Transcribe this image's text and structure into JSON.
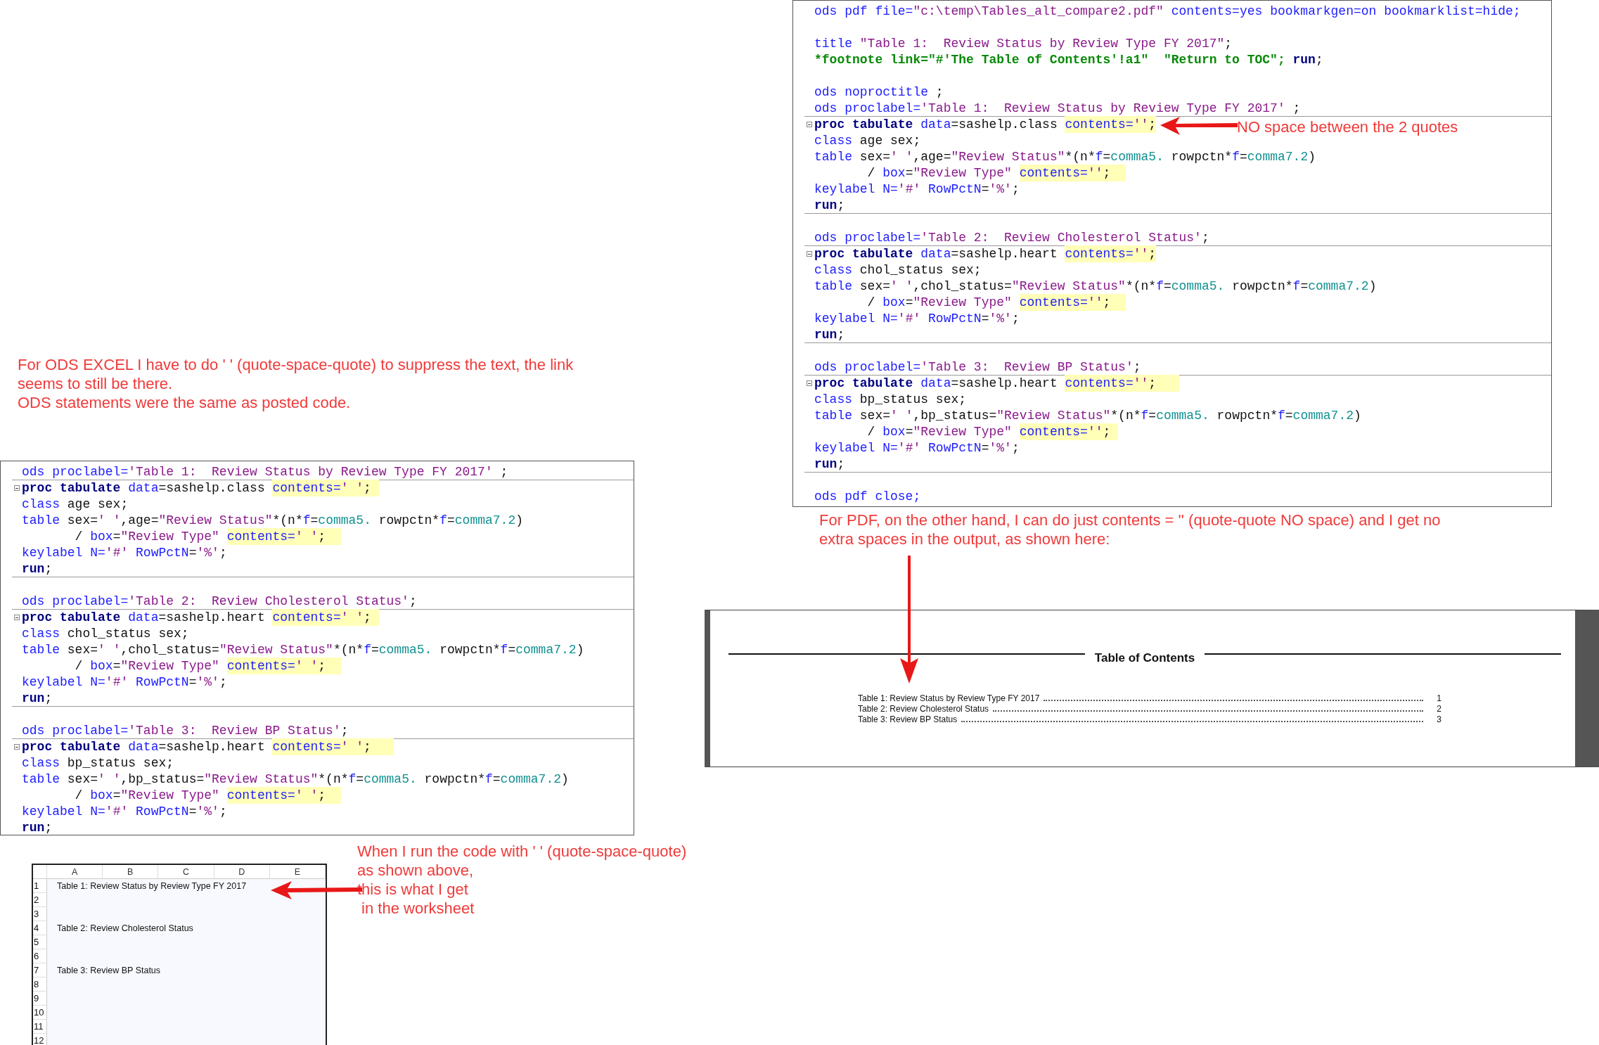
{
  "notes": [
    {
      "kind": "excel-note",
      "paragraphs": [
        "For ODS EXCEL I have to do ' ' (quote-space-quote) to suppress the text, the link seems to still be there.",
        "ODS statements were the same as posted code."
      ]
    },
    {
      "kind": "quote-note",
      "paragraphs": [
        "NO space between the 2 quotes"
      ]
    },
    {
      "kind": "pdf-note",
      "paragraphs": [
        "For PDF, on the other hand, I can do just contents = '' (quote-quote NO space) and I get no extra spaces in the output, as shown here:"
      ]
    },
    {
      "kind": "sheet-note",
      "paragraphs": [
        "When I run the code with ' ' (quote-space-quote)",
        "as shown above,",
        "this is what I get",
        " in the worksheet"
      ]
    }
  ],
  "pdf_code": {
    "lines": [
      {
        "kind": "code",
        "tokens": [
          {
            "kind": "keyword",
            "text": "ods pdf file="
          },
          {
            "kind": "string",
            "text": "\"c:\\temp\\Tables_alt_compare2.pdf\""
          },
          {
            "kind": "keyword",
            "text": " contents=yes bookmarkgen=on bookmarklist=hide;"
          }
        ]
      },
      {
        "kind": "blank"
      },
      {
        "kind": "code",
        "tokens": [
          {
            "kind": "keyword",
            "text": "title "
          },
          {
            "kind": "string",
            "text": "\"Table 1:  Review Status by Review Type FY 2017\""
          },
          {
            "kind": "plain",
            "text": ";"
          }
        ]
      },
      {
        "kind": "code",
        "tokens": [
          {
            "kind": "comment",
            "text": "*footnote link=\"#'The Table of Contents'!a1\"  \"Return to TOC\"; "
          },
          {
            "kind": "bold",
            "text": "run"
          },
          {
            "kind": "plain",
            "text": ";"
          }
        ]
      },
      {
        "kind": "blank"
      },
      {
        "kind": "code",
        "tokens": [
          {
            "kind": "keyword",
            "text": "ods noproctitle "
          },
          {
            "kind": "plain",
            "text": ";"
          }
        ]
      },
      {
        "kind": "code",
        "tokens": [
          {
            "kind": "keyword",
            "text": "ods proclabel="
          },
          {
            "kind": "string",
            "text": "'Table 1:  Review Status by Review Type FY 2017'"
          },
          {
            "kind": "plain",
            "text": " ;"
          }
        ]
      },
      {
        "kind": "code",
        "fold": true,
        "divider": true,
        "tokens": [
          {
            "kind": "bold",
            "text": "proc tabulate"
          },
          {
            "kind": "keyword",
            "text": " data"
          },
          {
            "kind": "plain",
            "text": "=sashelp.class "
          },
          {
            "kind": "highlight",
            "children": [
              {
                "kind": "keyword",
                "text": "contents="
              },
              {
                "kind": "string",
                "text": "''"
              },
              {
                "kind": "plain",
                "text": ";"
              }
            ]
          }
        ]
      },
      {
        "kind": "code",
        "tokens": [
          {
            "kind": "keyword",
            "text": "class "
          },
          {
            "kind": "plain",
            "text": "age sex;"
          }
        ]
      },
      {
        "kind": "code",
        "tokens": [
          {
            "kind": "keyword",
            "text": "table "
          },
          {
            "kind": "plain",
            "text": "sex="
          },
          {
            "kind": "string",
            "text": "' '"
          },
          {
            "kind": "plain",
            "text": ",age="
          },
          {
            "kind": "string",
            "text": "\"Review Status\""
          },
          {
            "kind": "plain",
            "text": "*(n*"
          },
          {
            "kind": "keyword",
            "text": "f"
          },
          {
            "kind": "plain",
            "text": "="
          },
          {
            "kind": "format",
            "text": "comma5."
          },
          {
            "kind": "plain",
            "text": " rowpctn*"
          },
          {
            "kind": "keyword",
            "text": "f"
          },
          {
            "kind": "plain",
            "text": "="
          },
          {
            "kind": "format",
            "text": "comma7.2"
          },
          {
            "kind": "plain",
            "text": ")"
          }
        ]
      },
      {
        "kind": "code",
        "tokens": [
          {
            "kind": "plain",
            "text": "       / "
          },
          {
            "kind": "keyword",
            "text": "box"
          },
          {
            "kind": "plain",
            "text": "="
          },
          {
            "kind": "string",
            "text": "\"Review Type\" "
          },
          {
            "kind": "highlight",
            "children": [
              {
                "kind": "keyword",
                "text": "contents="
              },
              {
                "kind": "string",
                "text": "''"
              },
              {
                "kind": "plain",
                "text": ";  "
              }
            ]
          }
        ]
      },
      {
        "kind": "code",
        "tokens": [
          {
            "kind": "keyword",
            "text": "keylabel N="
          },
          {
            "kind": "string",
            "text": "'#'"
          },
          {
            "kind": "keyword",
            "text": " RowPctN"
          },
          {
            "kind": "plain",
            "text": "="
          },
          {
            "kind": "string",
            "text": "'%'"
          },
          {
            "kind": "plain",
            "text": ";"
          }
        ]
      },
      {
        "kind": "code",
        "tokens": [
          {
            "kind": "bold",
            "text": "run"
          },
          {
            "kind": "plain",
            "text": ";"
          }
        ]
      },
      {
        "kind": "blank",
        "divider": true
      },
      {
        "kind": "code",
        "tokens": [
          {
            "kind": "keyword",
            "text": "ods proclabel="
          },
          {
            "kind": "string",
            "text": "'Table 2:  Review Cholesterol Status'"
          },
          {
            "kind": "plain",
            "text": ";"
          }
        ]
      },
      {
        "kind": "code",
        "fold": true,
        "divider": true,
        "tokens": [
          {
            "kind": "bold",
            "text": "proc tabulate"
          },
          {
            "kind": "keyword",
            "text": " data"
          },
          {
            "kind": "plain",
            "text": "=sashelp.heart "
          },
          {
            "kind": "highlight",
            "children": [
              {
                "kind": "keyword",
                "text": "contents="
              },
              {
                "kind": "string",
                "text": "''"
              },
              {
                "kind": "plain",
                "text": ";"
              }
            ]
          }
        ]
      },
      {
        "kind": "code",
        "tokens": [
          {
            "kind": "keyword",
            "text": "class "
          },
          {
            "kind": "plain",
            "text": "chol_status sex;"
          }
        ]
      },
      {
        "kind": "code",
        "tokens": [
          {
            "kind": "keyword",
            "text": "table "
          },
          {
            "kind": "plain",
            "text": "sex="
          },
          {
            "kind": "string",
            "text": "' '"
          },
          {
            "kind": "plain",
            "text": ",chol_status="
          },
          {
            "kind": "string",
            "text": "\"Review Status\""
          },
          {
            "kind": "plain",
            "text": "*(n*"
          },
          {
            "kind": "keyword",
            "text": "f"
          },
          {
            "kind": "plain",
            "text": "="
          },
          {
            "kind": "format",
            "text": "comma5."
          },
          {
            "kind": "plain",
            "text": " rowpctn*"
          },
          {
            "kind": "keyword",
            "text": "f"
          },
          {
            "kind": "plain",
            "text": "="
          },
          {
            "kind": "format",
            "text": "comma7.2"
          },
          {
            "kind": "plain",
            "text": ")"
          }
        ]
      },
      {
        "kind": "code",
        "tokens": [
          {
            "kind": "plain",
            "text": "       / "
          },
          {
            "kind": "keyword",
            "text": "box"
          },
          {
            "kind": "plain",
            "text": "="
          },
          {
            "kind": "string",
            "text": "\"Review Type\" "
          },
          {
            "kind": "highlight",
            "children": [
              {
                "kind": "keyword",
                "text": "contents="
              },
              {
                "kind": "string",
                "text": "''"
              },
              {
                "kind": "plain",
                "text": ";  "
              }
            ]
          }
        ]
      },
      {
        "kind": "code",
        "tokens": [
          {
            "kind": "keyword",
            "text": "keylabel N="
          },
          {
            "kind": "string",
            "text": "'#'"
          },
          {
            "kind": "keyword",
            "text": " RowPctN"
          },
          {
            "kind": "plain",
            "text": "="
          },
          {
            "kind": "string",
            "text": "'%'"
          },
          {
            "kind": "plain",
            "text": ";"
          }
        ]
      },
      {
        "kind": "code",
        "tokens": [
          {
            "kind": "bold",
            "text": "run"
          },
          {
            "kind": "plain",
            "text": ";"
          }
        ]
      },
      {
        "kind": "blank",
        "divider": true
      },
      {
        "kind": "code",
        "tokens": [
          {
            "kind": "keyword",
            "text": "ods proclabel="
          },
          {
            "kind": "string",
            "text": "'Table 3:  Review BP Status'"
          },
          {
            "kind": "plain",
            "text": ";"
          }
        ]
      },
      {
        "kind": "code",
        "fold": true,
        "divider": true,
        "tokens": [
          {
            "kind": "bold",
            "text": "proc tabulate"
          },
          {
            "kind": "keyword",
            "text": " data"
          },
          {
            "kind": "plain",
            "text": "=sashelp.heart "
          },
          {
            "kind": "highlight",
            "children": [
              {
                "kind": "keyword",
                "text": "contents="
              },
              {
                "kind": "string",
                "text": "''"
              },
              {
                "kind": "plain",
                "text": ";   "
              }
            ]
          }
        ]
      },
      {
        "kind": "code",
        "tokens": [
          {
            "kind": "keyword",
            "text": "class "
          },
          {
            "kind": "plain",
            "text": "bp_status sex;"
          }
        ]
      },
      {
        "kind": "code",
        "tokens": [
          {
            "kind": "keyword",
            "text": "table "
          },
          {
            "kind": "plain",
            "text": "sex="
          },
          {
            "kind": "string",
            "text": "' '"
          },
          {
            "kind": "plain",
            "text": ",bp_status="
          },
          {
            "kind": "string",
            "text": "\"Review Status\""
          },
          {
            "kind": "plain",
            "text": "*(n*"
          },
          {
            "kind": "keyword",
            "text": "f"
          },
          {
            "kind": "plain",
            "text": "="
          },
          {
            "kind": "format",
            "text": "comma5."
          },
          {
            "kind": "plain",
            "text": " rowpctn*"
          },
          {
            "kind": "keyword",
            "text": "f"
          },
          {
            "kind": "plain",
            "text": "="
          },
          {
            "kind": "format",
            "text": "comma7.2"
          },
          {
            "kind": "plain",
            "text": ")"
          }
        ]
      },
      {
        "kind": "code",
        "tokens": [
          {
            "kind": "plain",
            "text": "       / "
          },
          {
            "kind": "keyword",
            "text": "box"
          },
          {
            "kind": "plain",
            "text": "="
          },
          {
            "kind": "string",
            "text": "\"Review Type\" "
          },
          {
            "kind": "highlight",
            "children": [
              {
                "kind": "keyword",
                "text": "contents="
              },
              {
                "kind": "string",
                "text": "''"
              },
              {
                "kind": "plain",
                "text": "; "
              }
            ]
          }
        ]
      },
      {
        "kind": "code",
        "tokens": [
          {
            "kind": "keyword",
            "text": "keylabel N="
          },
          {
            "kind": "string",
            "text": "'#'"
          },
          {
            "kind": "keyword",
            "text": " RowPctN"
          },
          {
            "kind": "plain",
            "text": "="
          },
          {
            "kind": "string",
            "text": "'%'"
          },
          {
            "kind": "plain",
            "text": ";"
          }
        ]
      },
      {
        "kind": "code",
        "tokens": [
          {
            "kind": "bold",
            "text": "run"
          },
          {
            "kind": "plain",
            "text": ";"
          }
        ]
      },
      {
        "kind": "blank",
        "divider": true
      },
      {
        "kind": "code",
        "tokens": [
          {
            "kind": "keyword",
            "text": "ods pdf close;"
          }
        ]
      }
    ]
  },
  "excel_code": {
    "lines": [
      {
        "kind": "code",
        "tokens": [
          {
            "kind": "keyword",
            "text": "ods proclabel="
          },
          {
            "kind": "string",
            "text": "'Table 1:  Review Status by Review Type FY 2017'"
          },
          {
            "kind": "plain",
            "text": " ;"
          }
        ]
      },
      {
        "kind": "code",
        "fold": true,
        "divider": true,
        "tokens": [
          {
            "kind": "bold",
            "text": "proc tabulate"
          },
          {
            "kind": "keyword",
            "text": " data"
          },
          {
            "kind": "plain",
            "text": "=sashelp.class "
          },
          {
            "kind": "highlight",
            "children": [
              {
                "kind": "keyword",
                "text": "contents="
              },
              {
                "kind": "string",
                "text": "' '"
              },
              {
                "kind": "plain",
                "text": "; "
              }
            ]
          }
        ]
      },
      {
        "kind": "code",
        "tokens": [
          {
            "kind": "keyword",
            "text": "class "
          },
          {
            "kind": "plain",
            "text": "age sex;"
          }
        ]
      },
      {
        "kind": "code",
        "tokens": [
          {
            "kind": "keyword",
            "text": "table "
          },
          {
            "kind": "plain",
            "text": "sex="
          },
          {
            "kind": "string",
            "text": "' '"
          },
          {
            "kind": "plain",
            "text": ",age="
          },
          {
            "kind": "string",
            "text": "\"Review Status\""
          },
          {
            "kind": "plain",
            "text": "*(n*"
          },
          {
            "kind": "keyword",
            "text": "f"
          },
          {
            "kind": "plain",
            "text": "="
          },
          {
            "kind": "format",
            "text": "comma5."
          },
          {
            "kind": "plain",
            "text": " rowpctn*"
          },
          {
            "kind": "keyword",
            "text": "f"
          },
          {
            "kind": "plain",
            "text": "="
          },
          {
            "kind": "format",
            "text": "comma7.2"
          },
          {
            "kind": "plain",
            "text": ")"
          }
        ]
      },
      {
        "kind": "code",
        "tokens": [
          {
            "kind": "plain",
            "text": "       / "
          },
          {
            "kind": "keyword",
            "text": "box"
          },
          {
            "kind": "plain",
            "text": "="
          },
          {
            "kind": "string",
            "text": "\"Review Type\" "
          },
          {
            "kind": "highlight",
            "children": [
              {
                "kind": "keyword",
                "text": "contents="
              },
              {
                "kind": "string",
                "text": "' '"
              },
              {
                "kind": "plain",
                "text": ";  "
              }
            ]
          }
        ]
      },
      {
        "kind": "code",
        "tokens": [
          {
            "kind": "keyword",
            "text": "keylabel N="
          },
          {
            "kind": "string",
            "text": "'#'"
          },
          {
            "kind": "keyword",
            "text": " RowPctN"
          },
          {
            "kind": "plain",
            "text": "="
          },
          {
            "kind": "string",
            "text": "'%'"
          },
          {
            "kind": "plain",
            "text": ";"
          }
        ]
      },
      {
        "kind": "code",
        "tokens": [
          {
            "kind": "bold",
            "text": "run"
          },
          {
            "kind": "plain",
            "text": ";"
          }
        ]
      },
      {
        "kind": "blank",
        "divider": true
      },
      {
        "kind": "code",
        "tokens": [
          {
            "kind": "keyword",
            "text": "ods proclabel="
          },
          {
            "kind": "string",
            "text": "'Table 2:  Review Cholesterol Status'"
          },
          {
            "kind": "plain",
            "text": ";"
          }
        ]
      },
      {
        "kind": "code",
        "fold": true,
        "divider": true,
        "tokens": [
          {
            "kind": "bold",
            "text": "proc tabulate"
          },
          {
            "kind": "keyword",
            "text": " data"
          },
          {
            "kind": "plain",
            "text": "=sashelp.heart "
          },
          {
            "kind": "highlight",
            "children": [
              {
                "kind": "keyword",
                "text": "contents="
              },
              {
                "kind": "string",
                "text": "' '"
              },
              {
                "kind": "plain",
                "text": "; "
              }
            ]
          }
        ]
      },
      {
        "kind": "code",
        "tokens": [
          {
            "kind": "keyword",
            "text": "class "
          },
          {
            "kind": "plain",
            "text": "chol_status sex;"
          }
        ]
      },
      {
        "kind": "code",
        "tokens": [
          {
            "kind": "keyword",
            "text": "table "
          },
          {
            "kind": "plain",
            "text": "sex="
          },
          {
            "kind": "string",
            "text": "' '"
          },
          {
            "kind": "plain",
            "text": ",chol_status="
          },
          {
            "kind": "string",
            "text": "\"Review Status\""
          },
          {
            "kind": "plain",
            "text": "*(n*"
          },
          {
            "kind": "keyword",
            "text": "f"
          },
          {
            "kind": "plain",
            "text": "="
          },
          {
            "kind": "format",
            "text": "comma5."
          },
          {
            "kind": "plain",
            "text": " rowpctn*"
          },
          {
            "kind": "keyword",
            "text": "f"
          },
          {
            "kind": "plain",
            "text": "="
          },
          {
            "kind": "format",
            "text": "comma7.2"
          },
          {
            "kind": "plain",
            "text": ")"
          }
        ]
      },
      {
        "kind": "code",
        "tokens": [
          {
            "kind": "plain",
            "text": "       / "
          },
          {
            "kind": "keyword",
            "text": "box"
          },
          {
            "kind": "plain",
            "text": "="
          },
          {
            "kind": "string",
            "text": "\"Review Type\" "
          },
          {
            "kind": "highlight",
            "children": [
              {
                "kind": "keyword",
                "text": "contents="
              },
              {
                "kind": "string",
                "text": "' '"
              },
              {
                "kind": "plain",
                "text": ";  "
              }
            ]
          }
        ]
      },
      {
        "kind": "code",
        "tokens": [
          {
            "kind": "keyword",
            "text": "keylabel N="
          },
          {
            "kind": "string",
            "text": "'#'"
          },
          {
            "kind": "keyword",
            "text": " RowPctN"
          },
          {
            "kind": "plain",
            "text": "="
          },
          {
            "kind": "string",
            "text": "'%'"
          },
          {
            "kind": "plain",
            "text": ";"
          }
        ]
      },
      {
        "kind": "code",
        "tokens": [
          {
            "kind": "bold",
            "text": "run"
          },
          {
            "kind": "plain",
            "text": ";"
          }
        ]
      },
      {
        "kind": "blank",
        "divider": true
      },
      {
        "kind": "code",
        "tokens": [
          {
            "kind": "keyword",
            "text": "ods proclabel="
          },
          {
            "kind": "string",
            "text": "'Table 3:  Review BP Status'"
          },
          {
            "kind": "plain",
            "text": ";"
          }
        ]
      },
      {
        "kind": "code",
        "fold": true,
        "divider": true,
        "tokens": [
          {
            "kind": "bold",
            "text": "proc tabulate"
          },
          {
            "kind": "keyword",
            "text": " data"
          },
          {
            "kind": "plain",
            "text": "=sashelp.heart "
          },
          {
            "kind": "highlight",
            "children": [
              {
                "kind": "keyword",
                "text": "contents="
              },
              {
                "kind": "string",
                "text": "' '"
              },
              {
                "kind": "plain",
                "text": ";   "
              }
            ]
          }
        ]
      },
      {
        "kind": "code",
        "tokens": [
          {
            "kind": "keyword",
            "text": "class "
          },
          {
            "kind": "plain",
            "text": "bp_status sex;"
          }
        ]
      },
      {
        "kind": "code",
        "tokens": [
          {
            "kind": "keyword",
            "text": "table "
          },
          {
            "kind": "plain",
            "text": "sex="
          },
          {
            "kind": "string",
            "text": "' '"
          },
          {
            "kind": "plain",
            "text": ",bp_status="
          },
          {
            "kind": "string",
            "text": "\"Review Status\""
          },
          {
            "kind": "plain",
            "text": "*(n*"
          },
          {
            "kind": "keyword",
            "text": "f"
          },
          {
            "kind": "plain",
            "text": "="
          },
          {
            "kind": "format",
            "text": "comma5."
          },
          {
            "kind": "plain",
            "text": " rowpctn*"
          },
          {
            "kind": "keyword",
            "text": "f"
          },
          {
            "kind": "plain",
            "text": "="
          },
          {
            "kind": "format",
            "text": "comma7.2"
          },
          {
            "kind": "plain",
            "text": ")"
          }
        ]
      },
      {
        "kind": "code",
        "tokens": [
          {
            "kind": "plain",
            "text": "       / "
          },
          {
            "kind": "keyword",
            "text": "box"
          },
          {
            "kind": "plain",
            "text": "="
          },
          {
            "kind": "string",
            "text": "\"Review Type\" "
          },
          {
            "kind": "highlight",
            "children": [
              {
                "kind": "keyword",
                "text": "contents="
              },
              {
                "kind": "string",
                "text": "' '"
              },
              {
                "kind": "plain",
                "text": ";  "
              }
            ]
          }
        ]
      },
      {
        "kind": "code",
        "tokens": [
          {
            "kind": "keyword",
            "text": "keylabel N="
          },
          {
            "kind": "string",
            "text": "'#'"
          },
          {
            "kind": "keyword",
            "text": " RowPctN"
          },
          {
            "kind": "plain",
            "text": "="
          },
          {
            "kind": "string",
            "text": "'%'"
          },
          {
            "kind": "plain",
            "text": ";"
          }
        ]
      },
      {
        "kind": "code",
        "tokens": [
          {
            "kind": "bold",
            "text": "run"
          },
          {
            "kind": "plain",
            "text": ";"
          }
        ]
      }
    ]
  },
  "toc": {
    "title": "Table of Contents",
    "entries": [
      {
        "label": "Table 1:  Review Status by Review Type FY 2017",
        "page": "1"
      },
      {
        "label": "Table 2:  Review Cholesterol Status",
        "page": "2"
      },
      {
        "label": "Table 3:  Review BP Status",
        "page": "3"
      }
    ]
  },
  "worksheet": {
    "columns": [
      "A",
      "B",
      "C",
      "D",
      "E"
    ],
    "rows": [
      {
        "number": "1",
        "cell_a": "Table 1:  Review Status by Review Type FY 2017"
      },
      {
        "number": "2"
      },
      {
        "number": "3"
      },
      {
        "number": "4",
        "cell_a": "Table 2:  Review Cholesterol Status"
      },
      {
        "number": "5"
      },
      {
        "number": "6"
      },
      {
        "number": "7",
        "cell_a": "Table 3:  Review BP Status"
      },
      {
        "number": "8"
      },
      {
        "number": "9"
      },
      {
        "number": "10"
      },
      {
        "number": "11"
      },
      {
        "number": "12"
      }
    ]
  }
}
